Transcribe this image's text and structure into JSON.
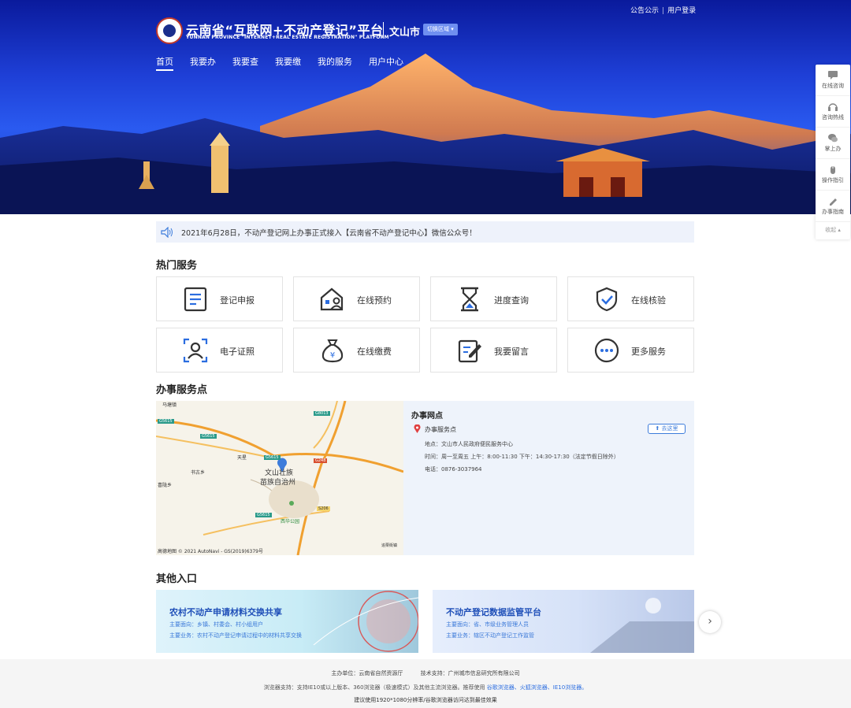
{
  "header": {
    "links": [
      "公告公示",
      "用户登录"
    ],
    "site_title": "云南省“互联网+不动产登记”平台",
    "site_subtitle": "YUNNAN PROVINCE \"INTERNET+REAL ESTATE REGISTRATION\" PLATFORM",
    "city": "文山市",
    "switch_label": "切换区域 ▾",
    "nav": [
      "首页",
      "我要办",
      "我要查",
      "我要缴",
      "我的服务",
      "用户中心"
    ]
  },
  "sidebar": {
    "items": [
      {
        "label": "在线咨询",
        "icon": "chat-icon"
      },
      {
        "label": "咨询热线",
        "icon": "headset-icon"
      },
      {
        "label": "掌上办",
        "icon": "wechat-icon"
      },
      {
        "label": "操作指引",
        "icon": "mouse-icon"
      },
      {
        "label": "办事指南",
        "icon": "pen-icon"
      }
    ],
    "collapse": "收起 ▴"
  },
  "notice": {
    "text": "2021年6月28日，不动产登记网上办事正式接入【云南省不动产登记中心】微信公众号！"
  },
  "hot_services": {
    "title": "热门服务",
    "items": [
      {
        "label": "登记申报",
        "icon": "document-icon"
      },
      {
        "label": "在线预约",
        "icon": "house-person-icon"
      },
      {
        "label": "进度查询",
        "icon": "hourglass-icon"
      },
      {
        "label": "在线核验",
        "icon": "shield-check-icon"
      },
      {
        "label": "电子证照",
        "icon": "person-scan-icon"
      },
      {
        "label": "在线缴费",
        "icon": "money-bag-icon"
      },
      {
        "label": "我要留言",
        "icon": "edit-note-icon"
      },
      {
        "label": "更多服务",
        "icon": "more-icon"
      }
    ]
  },
  "service_points": {
    "title": "办事服务点",
    "map": {
      "labels": [
        "马塘镇",
        "G8013",
        "G5615",
        "G5615",
        "天星",
        "G5615",
        "G248",
        "书古乡",
        "文山壮族",
        "苗族自治州",
        "喜陇乡",
        "S206",
        "G5615",
        "西华公园",
        "追栗街镇"
      ],
      "attribution": "高德地图 © 2021 AutoNavi - GS(2019)6379号"
    },
    "panel_title": "办事网点",
    "point_name": "办事服务点",
    "go_label": "去这里",
    "address": "地点：文山市人民政府便民服务中心",
    "hours": "时间：周一至周五 上午：8:00-11:30 下午：14:30-17:30（法定节假日除外）",
    "phone": "电话：0876-3037964"
  },
  "other_entries": {
    "title": "其他入口",
    "items": [
      {
        "title": "农村不动产申请材料交换共享",
        "line1": "主要面向：乡镇、村委会、村小组用户",
        "line2": "主要业务：农村不动产登记申请过程中的材料共享交换"
      },
      {
        "title": "不动产登记数据监管平台",
        "line1": "主要面向：省、市级业务管理人员",
        "line2": "主要业务：辖区不动产登记工作监管"
      }
    ],
    "next": "›"
  },
  "footer": {
    "sponsor": "主办单位：云南省自然资源厅",
    "support": "技术支持：广州城市信息研究所有限公司",
    "browser_pre": "浏览器支持：支持IE10或以上版本、360浏览器（极速模式）及其他主流浏览器。推荐使用",
    "browsers": [
      "谷歌浏览器、",
      "火狐浏览器、",
      "IE10浏览器。"
    ],
    "resolution": "建议使用1920*1080分辨率/谷歌浏览器访问达到最佳效果"
  },
  "colors": {
    "accent": "#2b6de0",
    "banner_blue": "#1e3fd6",
    "card_border": "#e3e3e3"
  }
}
